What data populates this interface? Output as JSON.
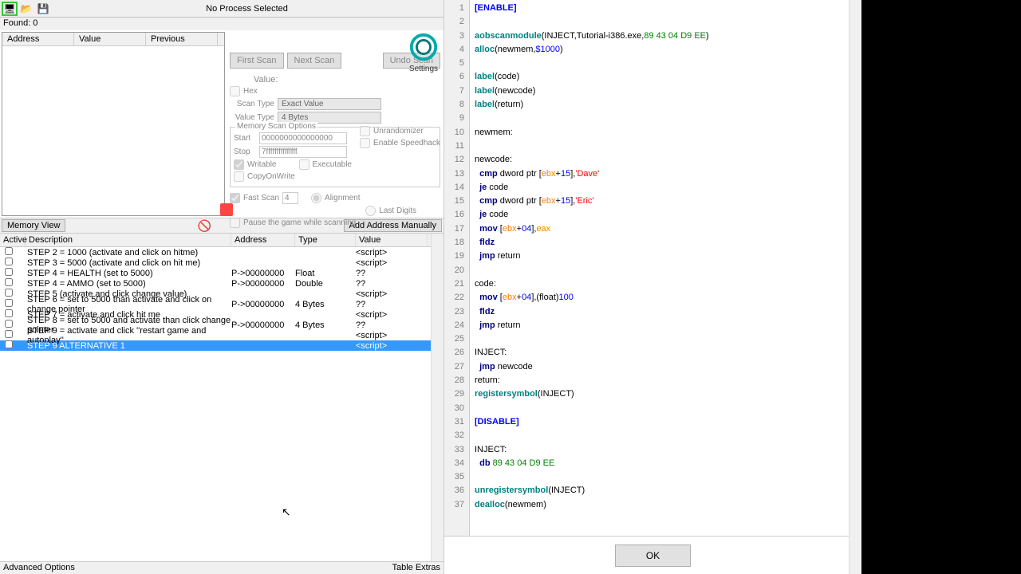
{
  "toolbar": {
    "process_label": "No Process Selected"
  },
  "found": {
    "label": "Found: 0"
  },
  "addrlist": {
    "h1": "Address",
    "h2": "Value",
    "h3": "Previous"
  },
  "scan": {
    "first": "First Scan",
    "next": "Next Scan",
    "undo": "Undo Scan",
    "value_label": "Value:",
    "hex": "Hex",
    "scantype_label": "Scan Type",
    "scantype": "Exact Value",
    "valuetype_label": "Value Type",
    "valuetype": "4 Bytes",
    "mem_opts": "Memory Scan Options",
    "start": "Start",
    "start_v": "0000000000000000",
    "stop": "Stop",
    "stop_v": "7fffffffffffffff",
    "writable": "Writable",
    "executable": "Executable",
    "cow": "CopyOnWrite",
    "unrand": "Unrandomizer",
    "speedhack": "Enable Speedhack",
    "fastscan": "Fast Scan",
    "fastscan_v": "4",
    "align": "Alignment",
    "lastdig": "Last Digits",
    "pause": "Pause the game while scanning"
  },
  "logo": {
    "settings": "Settings"
  },
  "mid": {
    "memview": "Memory View",
    "addman": "Add Address Manually"
  },
  "table": {
    "h_active": "Active",
    "h_desc": "Description",
    "h_addr": "Address",
    "h_type": "Type",
    "h_value": "Value",
    "rows": [
      {
        "d": "STEP 2 = 1000 (activate and click on hitme)",
        "a": "",
        "t": "",
        "v": "<script>"
      },
      {
        "d": "STEP 3 = 5000 (activate and click on hit me)",
        "a": "",
        "t": "",
        "v": "<script>"
      },
      {
        "d": "STEP 4 = HEALTH (set to 5000)",
        "a": "P->00000000",
        "t": "Float",
        "v": "??"
      },
      {
        "d": "STEP 4 = AMMO (set to 5000)",
        "a": "P->00000000",
        "t": "Double",
        "v": "??"
      },
      {
        "d": "STEP 5 (activate and click change value)",
        "a": "",
        "t": "",
        "v": "<script>"
      },
      {
        "d": "STEP 6 = set to 5000 than activate and click on change pointer",
        "a": "P->00000000",
        "t": "4 Bytes",
        "v": "??"
      },
      {
        "d": "STEP 7 = activate and click hit me",
        "a": "",
        "t": "",
        "v": "<script>"
      },
      {
        "d": "STEP 8 = set to 5000 and activate than click change pointer",
        "a": "P->00000000",
        "t": "4 Bytes",
        "v": "??"
      },
      {
        "d": "STEP 9 = activate and click ''restart game and autoplay''",
        "a": "",
        "t": "",
        "v": "<script>"
      },
      {
        "d": "STEP 9 ALTERNATIVE 1",
        "a": "",
        "t": "",
        "v": "<script>",
        "sel": true
      }
    ]
  },
  "bottom": {
    "adv": "Advanced Options",
    "extras": "Table Extras"
  },
  "ok": {
    "label": "OK"
  },
  "code_lines": 37
}
